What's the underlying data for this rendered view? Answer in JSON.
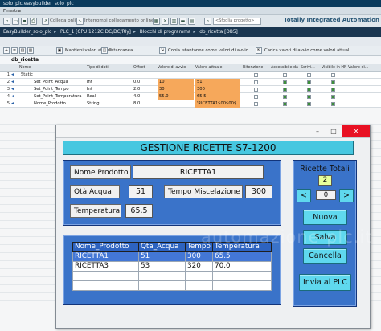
{
  "app": {
    "window_title": "solo_plc.easybuilder_solo_plc",
    "menu_label": "Finestra",
    "toolbar": {
      "go_online": "Collega online",
      "go_offline": "Interrompi collegamento online",
      "search_placeholder": "<Sfoglia progetto>",
      "brand": "Totally Integrated Automation"
    },
    "breadcrumb": [
      "EasyBuilder_solo_plc",
      "PLC_1 [CPU 1212C DC/DC/Rly]",
      "Blocchi di programma",
      "db_ricetta [DB5]"
    ],
    "editor_toolbar": {
      "keep_actual": "Mantieni valori attuali",
      "snapshot": "Istantanea",
      "copy_snapshot": "Copia istantanee come valori di avvio",
      "load_start": "Carica valori di avvio come valori attuali"
    },
    "block_title": "db_ricetta",
    "columns": [
      "Nome",
      "Tipo di dati",
      "Offset",
      "Valore di avvio",
      "Valore attuale",
      "Ritenzione",
      "Accessibile da HMI",
      "Scrivi...",
      "Visibile in HMI",
      "Valore di..."
    ],
    "rows": [
      {
        "num": "1",
        "name": "Static",
        "type": "",
        "offset": "",
        "start": "",
        "actual": "",
        "indent": 0,
        "checks": [
          false,
          false,
          false,
          false
        ]
      },
      {
        "num": "2",
        "name": "Set_Point_Acqua",
        "type": "Int",
        "offset": "0.0",
        "start": "10",
        "actual": "51",
        "indent": 1,
        "checks": [
          false,
          true,
          true,
          true
        ]
      },
      {
        "num": "3",
        "name": "Set_Point_Tempo",
        "type": "Int",
        "offset": "2.0",
        "start": "30",
        "actual": "300",
        "indent": 1,
        "checks": [
          false,
          true,
          true,
          true
        ]
      },
      {
        "num": "4",
        "name": "Set_Point_Temperatura",
        "type": "Real",
        "offset": "4.0",
        "start": "55.0",
        "actual": "65.5",
        "indent": 1,
        "checks": [
          false,
          true,
          true,
          true
        ]
      },
      {
        "num": "5",
        "name": "Nome_Prodotto",
        "type": "String",
        "offset": "8.0",
        "start": "",
        "actual": "'RICETTA1$00$00$...",
        "indent": 1,
        "checks": [
          false,
          true,
          true,
          true
        ]
      }
    ],
    "accent_orange": "#f6a85b"
  },
  "hmi": {
    "title": "GESTIONE RICETTE S7-1200",
    "product_label": "Nome Prodotto",
    "product_value": "RICETTA1",
    "water_label": "Qtà Acqua",
    "water_value": "51",
    "mix_time_label": "Tempo Miscelazione",
    "mix_time_value": "300",
    "temperature_label": "Temperatura",
    "temperature_value": "65.5",
    "total_label": "Ricette Totali",
    "total_value": "2",
    "index_value": "0",
    "prev_label": "<",
    "next_label": ">",
    "new_label": "Nuova",
    "save_label": "Salva",
    "delete_label": "Cancella",
    "send_label": "Invia al PLC",
    "table": {
      "headers": [
        "Nome_Prodotto",
        "Qta_Acqua",
        "Tempo",
        "Temperatura"
      ],
      "rows": [
        [
          "RICETTA1",
          "51",
          "300",
          "65.5"
        ],
        [
          "RICETTA3",
          "53",
          "320",
          "70.0"
        ]
      ]
    },
    "watermark": "automazione-plc.it",
    "panel_color": "#3a73c9",
    "button_color": "#5fd8ee"
  }
}
